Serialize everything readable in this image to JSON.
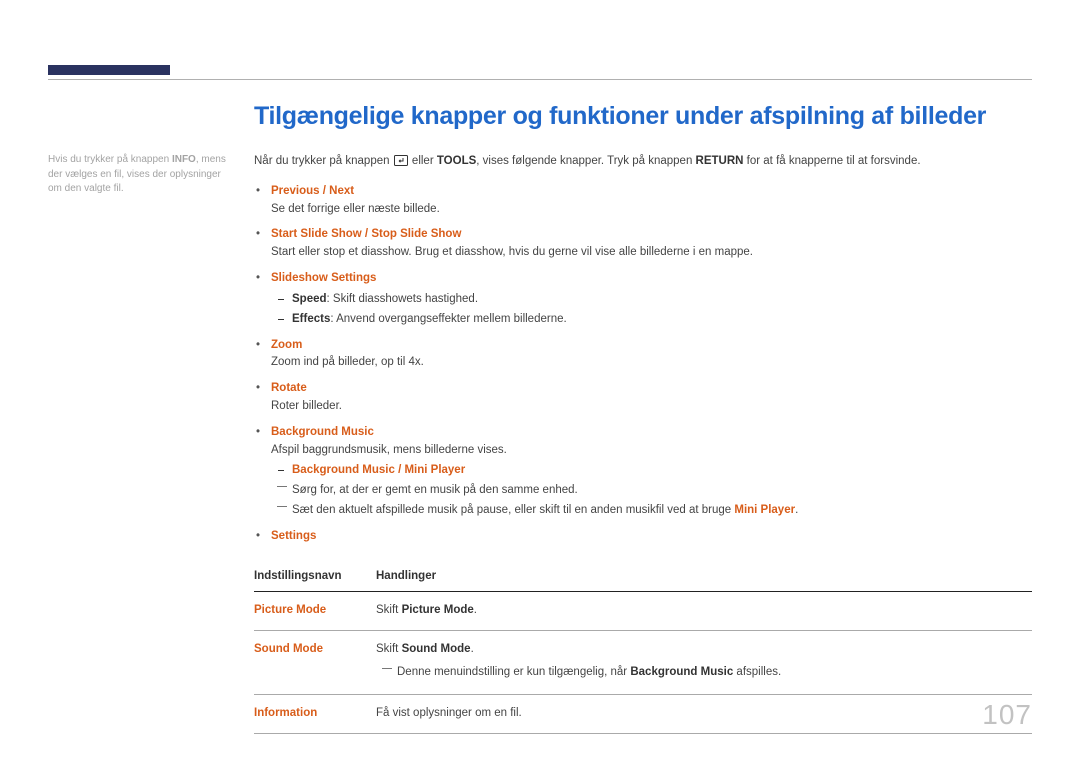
{
  "title": "Tilgængelige knapper og funktioner under afspilning af billeder",
  "sideNote": {
    "pre": "Hvis du trykker på knappen ",
    "bold": "INFO",
    "post": ", mens der vælges en fil, vises der oplysninger om den valgte fil."
  },
  "intro": {
    "a": "Når du trykker på knappen ",
    "b": " eller ",
    "tools": "TOOLS",
    "c": ", vises følgende knapper. Tryk på knappen ",
    "return": "RETURN",
    "d": " for at få knapperne til at forsvinde."
  },
  "items": {
    "prevnext": {
      "label": "Previous / Next",
      "desc": "Se det forrige eller næste billede."
    },
    "slideshow": {
      "label": "Start Slide Show / Stop Slide Show",
      "desc": "Start eller stop et diasshow. Brug et diasshow, hvis du gerne vil vise alle billederne i en mappe."
    },
    "slideset": {
      "label": "Slideshow Settings",
      "speed": {
        "k": "Speed",
        "t": ": Skift diasshowets hastighed."
      },
      "effects": {
        "k": "Effects",
        "t": ": Anvend overgangseffekter mellem billederne."
      }
    },
    "zoom": {
      "label": "Zoom",
      "desc": "Zoom ind på billeder, op til 4x."
    },
    "rotate": {
      "label": "Rotate",
      "desc": "Roter billeder."
    },
    "bgm": {
      "label": "Background Music",
      "desc": "Afspil baggrundsmusik, mens billederne vises.",
      "sub": {
        "label": "Background Music / Mini Player"
      },
      "note1": "Sørg for, at der er gemt en musik på den samme enhed.",
      "note2a": "Sæt den aktuelt afspillede musik på pause, eller skift til en anden musikfil ved at bruge ",
      "note2b": "Mini Player",
      "note2c": "."
    },
    "settings": {
      "label": "Settings"
    }
  },
  "tableHead": {
    "col1": "Indstillingsnavn",
    "col2": "Handlinger"
  },
  "tableRows": {
    "pic": {
      "name": "Picture Mode",
      "pre": "Skift ",
      "b": "Picture Mode",
      "post": "."
    },
    "snd": {
      "name": "Sound Mode",
      "pre": "Skift ",
      "b": "Sound Mode",
      "post": ".",
      "noteA": "Denne menuindstilling er kun tilgængelig, når ",
      "noteB": "Background Music",
      "noteC": " afspilles."
    },
    "info": {
      "name": "Information",
      "desc": "Få vist oplysninger om en fil."
    }
  },
  "pageNum": "107"
}
